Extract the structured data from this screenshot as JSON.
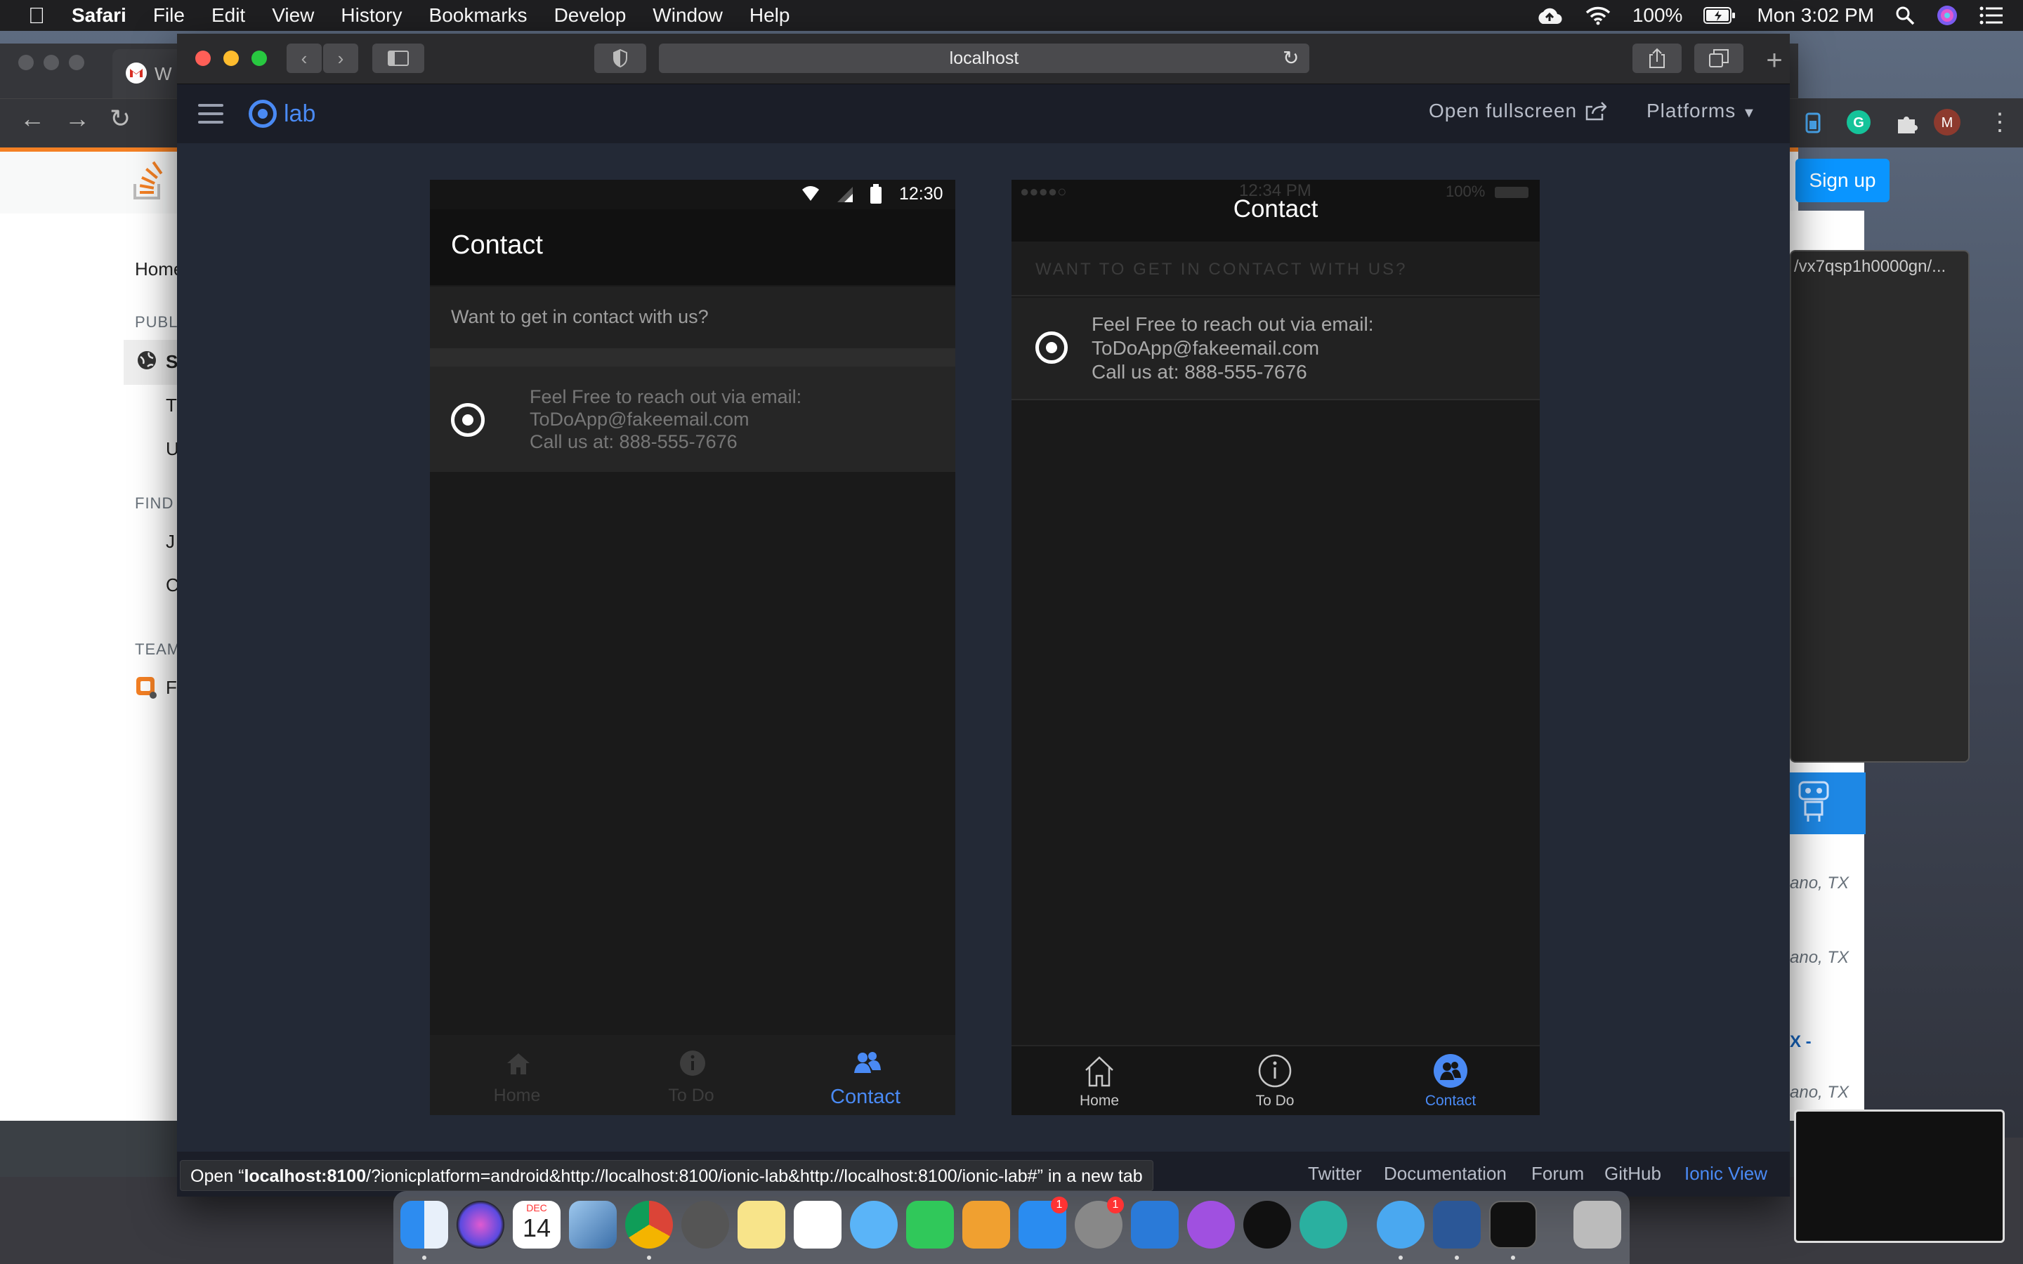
{
  "menubar": {
    "app": "Safari",
    "items": [
      "File",
      "Edit",
      "View",
      "History",
      "Bookmarks",
      "Develop",
      "Window",
      "Help"
    ],
    "battery": "100%",
    "clock": "Mon 3:02 PM"
  },
  "background": {
    "chrome_tab_label": "W",
    "so_sidebar": [
      "Home",
      "PUBL",
      "T",
      "U",
      "FIND A",
      "J",
      "C",
      "TEAM",
      "F"
    ],
    "signup": "Sign up",
    "terminal_title": "/vx7qsp1h0000gn/...",
    "locations": [
      "ano, TX",
      "ano, TX",
      "ano, TX"
    ],
    "x_label": "X -"
  },
  "safari": {
    "address": "localhost"
  },
  "lab": {
    "logo": "lab",
    "open_fullscreen": "Open fullscreen",
    "platforms": "Platforms"
  },
  "android": {
    "status_time": "12:30",
    "title": "Contact",
    "header": "Want to get in contact with us?",
    "lines": [
      "Feel Free to reach out via email:",
      "ToDoApp@fakeemail.com",
      "Call us at: 888-555-7676"
    ],
    "tabs": [
      "Home",
      "To Do",
      "Contact"
    ]
  },
  "ios": {
    "status_time": "12:34 PM",
    "status_battery": "100%",
    "title": "Contact",
    "header": "WANT TO GET IN CONTACT WITH US?",
    "lines": [
      "Feel Free to reach out via email:",
      "ToDoApp@fakeemail.com",
      "Call us at: 888-555-7676"
    ],
    "tabs": [
      "Home",
      "To Do",
      "Contact"
    ]
  },
  "footer": {
    "status_prefix": "Open “",
    "status_host": "localhost:8100",
    "status_rest": "/?ionicplatform=android&http://localhost:8100/ionic-lab&http://localhost:8100/ionic-lab#” in a new tab",
    "links": [
      "Twitter",
      "Documentation",
      "Forum",
      "GitHub",
      "Ionic View"
    ]
  },
  "dock": {
    "calendar_month": "DEC",
    "calendar_day": "14",
    "badges": [
      "1",
      "1"
    ]
  },
  "colors": {
    "ionic_blue": "#4a8af4",
    "so_orange": "#f48024",
    "signup_blue": "#0a95ff"
  }
}
